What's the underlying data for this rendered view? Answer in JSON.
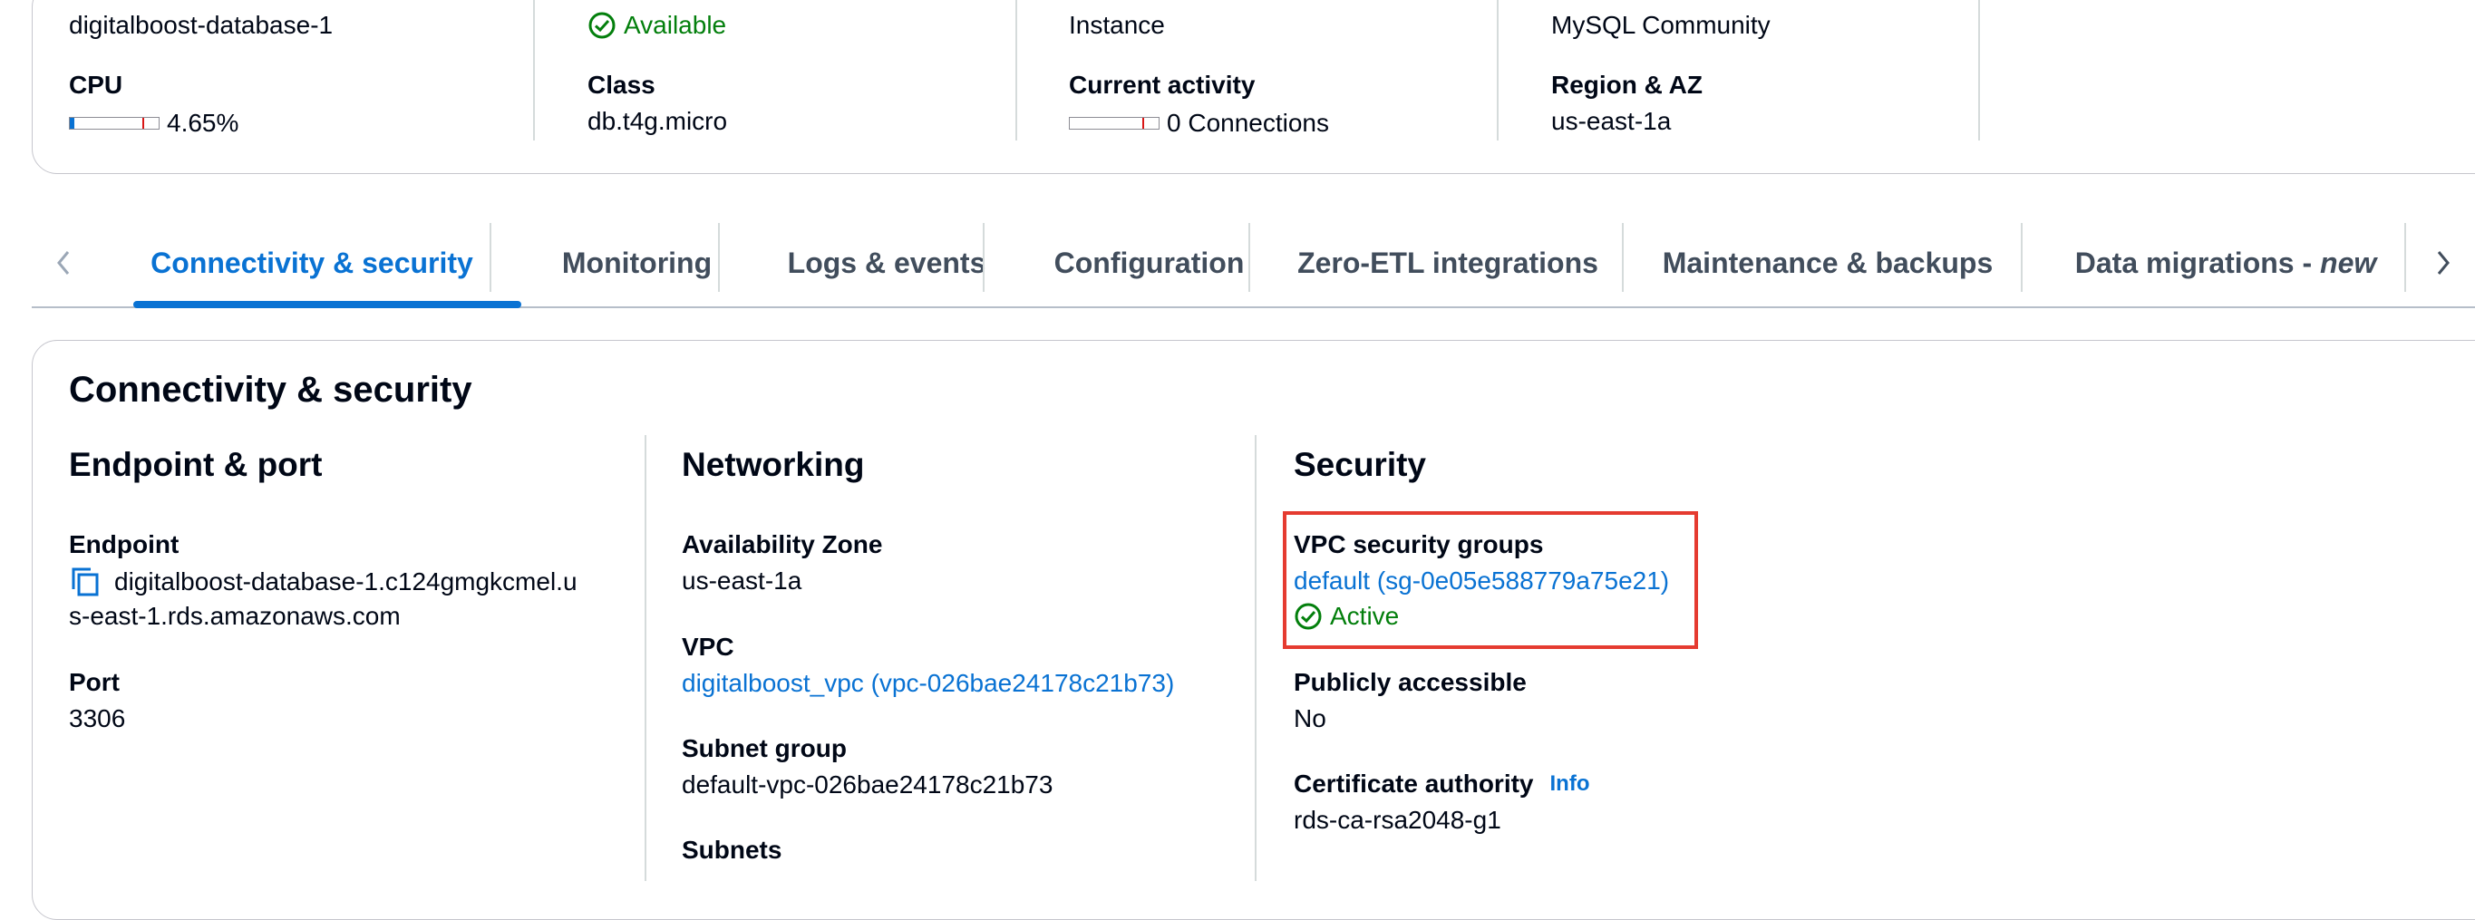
{
  "summary": {
    "col1": {
      "value_top": "digitalboost-database-1",
      "label": "CPU",
      "cpu_percent": "4.65%",
      "cpu_fraction": 0.0465
    },
    "col2": {
      "status": "Available",
      "label": "Class",
      "value": "db.t4g.micro"
    },
    "col3": {
      "value_top": "Instance",
      "label": "Current activity",
      "value": "0 Connections"
    },
    "col4": {
      "value_top": "MySQL Community",
      "label": "Region & AZ",
      "value": "us-east-1a"
    }
  },
  "tabs": [
    {
      "label": "Connectivity & security",
      "active": true
    },
    {
      "label": "Monitoring"
    },
    {
      "label": "Logs & events"
    },
    {
      "label": "Configuration"
    },
    {
      "label": "Zero-ETL integrations"
    },
    {
      "label": "Maintenance & backups"
    },
    {
      "label": "Data migrations - ",
      "suffix": "new"
    }
  ],
  "card": {
    "title": "Connectivity & security",
    "endpoint_port": {
      "title": "Endpoint & port",
      "endpoint_label": "Endpoint",
      "endpoint_line1": "digitalboost-database-1.c124gmgkcmel.u",
      "endpoint_line2": "s-east-1.rds.amazonaws.com",
      "port_label": "Port",
      "port_value": "3306"
    },
    "networking": {
      "title": "Networking",
      "az_label": "Availability Zone",
      "az_value": "us-east-1a",
      "vpc_label": "VPC",
      "vpc_value": "digitalboost_vpc (vpc-026bae24178c21b73)",
      "subnet_group_label": "Subnet group",
      "subnet_group_value": "default-vpc-026bae24178c21b73",
      "subnets_label": "Subnets"
    },
    "security": {
      "title": "Security",
      "vpc_sg_label": "VPC security groups",
      "vpc_sg_value": "default (sg-0e05e588779a75e21)",
      "vpc_sg_status": "Active",
      "public_label": "Publicly accessible",
      "public_value": "No",
      "ca_label": "Certificate authority",
      "ca_info": "Info",
      "ca_value": "rds-ca-rsa2048-g1"
    }
  },
  "colors": {
    "accent": "#0972d3",
    "success": "#037f0c",
    "highlight": "#e53b30"
  }
}
